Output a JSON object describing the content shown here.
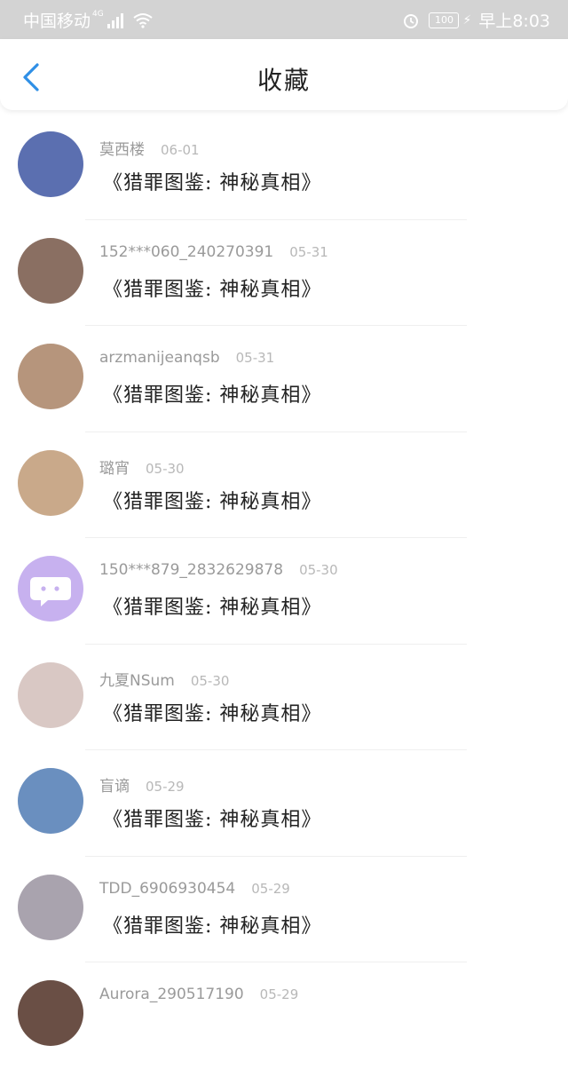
{
  "status_bar": {
    "carrier": "中国移动",
    "network": "4G",
    "battery": "100",
    "time": "早上8:03"
  },
  "header": {
    "title": "收藏"
  },
  "items": [
    {
      "name": "莫西楼",
      "date": "06-01",
      "subject": "《猎罪图鉴: 神秘真相》",
      "avatar_color": "#5b6fb0"
    },
    {
      "name": "152***060_240270391",
      "date": "05-31",
      "subject": "《猎罪图鉴: 神秘真相》",
      "avatar_color": "#8a6f62"
    },
    {
      "name": "arzmanijeanqsb",
      "date": "05-31",
      "subject": "《猎罪图鉴: 神秘真相》",
      "avatar_color": "#b6957c"
    },
    {
      "name": "璐宵",
      "date": "05-30",
      "subject": "《猎罪图鉴: 神秘真相》",
      "avatar_color": "#c9a98a"
    },
    {
      "name": "150***879_2832629878",
      "date": "05-30",
      "subject": "《猎罪图鉴: 神秘真相》",
      "avatar_color": "#c7b1ef"
    },
    {
      "name": "九夏NSum",
      "date": "05-30",
      "subject": "《猎罪图鉴: 神秘真相》",
      "avatar_color": "#d9c8c4"
    },
    {
      "name": "盲谪",
      "date": "05-29",
      "subject": "《猎罪图鉴: 神秘真相》",
      "avatar_color": "#6a8fbf"
    },
    {
      "name": "TDD_6906930454",
      "date": "05-29",
      "subject": "《猎罪图鉴: 神秘真相》",
      "avatar_color": "#a9a3ae"
    },
    {
      "name": "Aurora_290517190",
      "date": "05-29",
      "subject": "",
      "avatar_color": "#6a4f45"
    }
  ]
}
